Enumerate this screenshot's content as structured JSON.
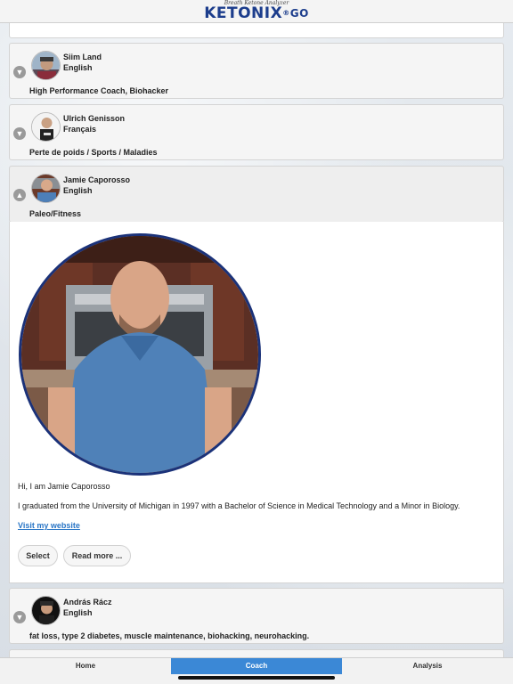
{
  "header": {
    "tagline": "Breath Ketone Analyzer",
    "brand": "KETONIX",
    "reg": "®",
    "suffix": "GO"
  },
  "coaches": [
    {
      "name": "Siim Land",
      "language": "English",
      "specialty": "High Performance Coach, Biohacker",
      "expanded": false
    },
    {
      "name": "Ulrich Genisson",
      "language": "Français",
      "specialty": "Perte de poids / Sports / Maladies",
      "expanded": false
    },
    {
      "name": "Jamie Caporosso",
      "language": "English",
      "specialty": "Paleo/Fitness",
      "expanded": true
    },
    {
      "name": "András Rácz",
      "language": "English",
      "specialty": "fat loss, type 2 diabetes, muscle maintenance, biohacking, neurohacking.",
      "expanded": false
    }
  ],
  "detail": {
    "greeting": "Hi, I am Jamie Caporosso",
    "bio": "I graduated from the University of Michigan in 1997 with a Bachelor of Science in Medical Technology and a Minor in Biology.",
    "website_link": "Visit my website",
    "select_label": "Select",
    "read_more_label": "Read more ..."
  },
  "tabs": [
    {
      "label": "Home",
      "active": false
    },
    {
      "label": "Coach",
      "active": true
    },
    {
      "label": "Analysis",
      "active": false
    }
  ],
  "icons": {
    "collapsed": "chevron-down-icon",
    "expanded": "chevron-up-icon"
  },
  "colors": {
    "brand": "#1c3d8c",
    "accent": "#3b88d6",
    "link": "#2a76c6",
    "photo_ring": "#1b3279"
  }
}
